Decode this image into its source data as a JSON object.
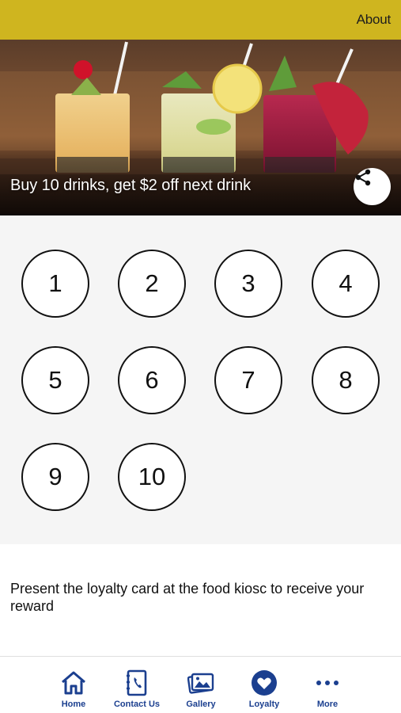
{
  "header": {
    "about_label": "About"
  },
  "hero": {
    "title": "Buy 10 drinks, get $2 off next drink",
    "share_icon": "share-icon"
  },
  "loyalty_card": {
    "stamps": [
      "1",
      "2",
      "3",
      "4",
      "5",
      "6",
      "7",
      "8",
      "9",
      "10"
    ]
  },
  "instructions": "Present the loyalty card at the food kiosc to receive your reward",
  "tab_bar": {
    "items": [
      {
        "label": "Home",
        "icon": "home-icon"
      },
      {
        "label": "Contact Us",
        "icon": "phone-book-icon"
      },
      {
        "label": "Gallery",
        "icon": "gallery-icon"
      },
      {
        "label": "Loyalty",
        "icon": "heart-icon"
      },
      {
        "label": "More",
        "icon": "more-dots-icon"
      }
    ]
  },
  "colors": {
    "header_bg": "#cfb51f",
    "accent": "#1b3f8f",
    "card_bg": "#f5f5f5"
  }
}
